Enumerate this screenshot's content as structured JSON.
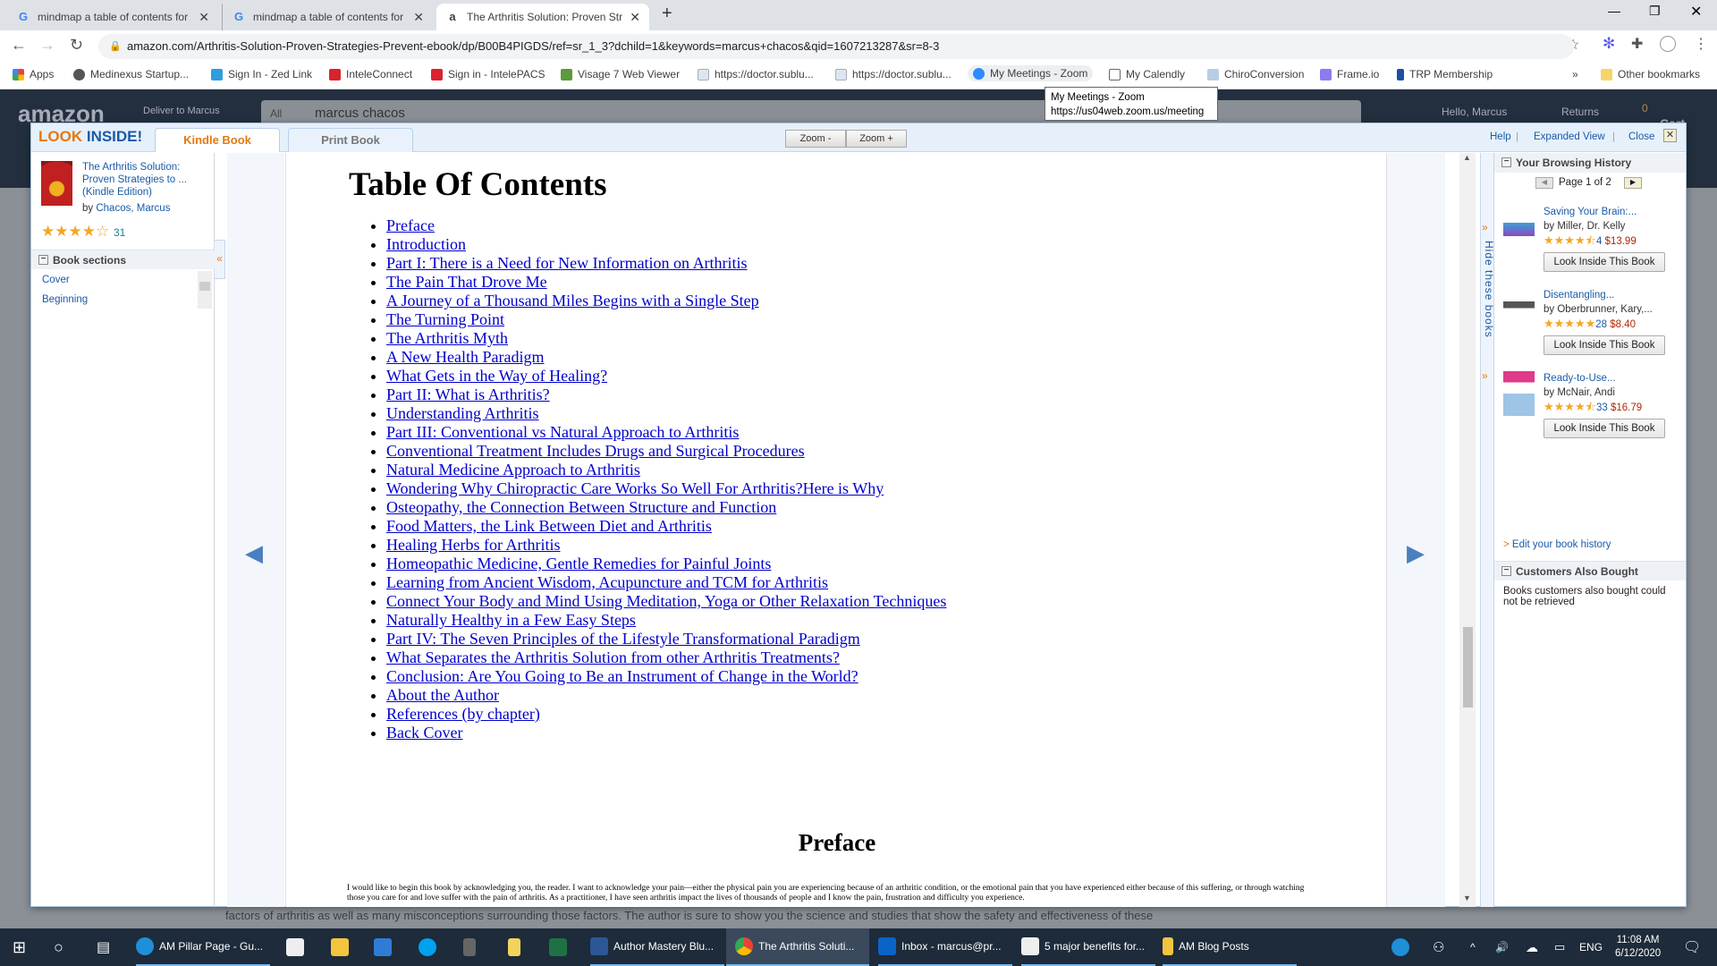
{
  "browser": {
    "tabs": [
      {
        "title": "mindmap a table of contents for",
        "icon": "google-icon"
      },
      {
        "title": "mindmap a table of contents for",
        "icon": "google-icon"
      },
      {
        "title": "The Arthritis Solution: Proven Str",
        "icon": "amazon-icon",
        "active": true
      }
    ],
    "url": "amazon.com/Arthritis-Solution-Proven-Strategies-Prevent-ebook/dp/B00B4PIGDS/ref=sr_1_3?dchild=1&keywords=marcus+chacos&qid=1607213287&sr=8-3",
    "bookmarks": [
      "Apps",
      "Medinexus Startup...",
      "Sign In - Zed Link",
      "InteleConnect",
      "Sign in - IntelePACS",
      "Visage 7 Web Viewer",
      "https://doctor.sublu...",
      "https://doctor.sublu...",
      "My Meetings - Zoom",
      "My Calendly",
      "ChiroConversion",
      "Frame.io",
      "TRP Membership"
    ],
    "other_bookmarks": "Other bookmarks",
    "tooltip": {
      "title": "My Meetings - Zoom",
      "url": "https://us04web.zoom.us/meeting"
    }
  },
  "amazon": {
    "logo": "amazon",
    "deliver": "Deliver to Marcus",
    "search_scope": "All",
    "search_value": "marcus chacos",
    "hello": "Hello, Marcus",
    "returns": "Returns",
    "cart_count": "0",
    "cart": "Cart"
  },
  "modal": {
    "logo_look": "LOOK",
    "logo_inside": "INSIDE!",
    "tabs": [
      "Kindle Book",
      "Print Book"
    ],
    "zoom_minus": "Zoom -",
    "zoom_plus": "Zoom +",
    "help": "Help",
    "expanded": "Expanded View",
    "close": "Close",
    "book": {
      "title": "The Arthritis Solution: Proven Strategies to ... (Kindle Edition)",
      "by": "by",
      "author": "Chacos, Marcus",
      "rating": 4,
      "reviews": "31"
    },
    "sections_header": "Book sections",
    "sections": [
      "Cover",
      "Beginning"
    ],
    "content": {
      "toc_title": "Table Of Contents",
      "toc": [
        "Preface",
        "Introduction",
        "Part I: There is a Need for New Information on Arthritis",
        "The Pain That Drove Me",
        "A Journey of a Thousand Miles Begins with a Single Step",
        "The Turning Point",
        "The Arthritis Myth",
        "A New Health Paradigm",
        "What Gets in the Way of Healing?",
        "Part II: What is Arthritis?",
        "Understanding Arthritis",
        "Part III: Conventional vs Natural Approach to Arthritis",
        "Conventional Treatment Includes Drugs and Surgical Procedures",
        "Natural Medicine Approach to Arthritis",
        "Wondering Why Chiropractic Care Works So Well For Arthritis?Here is Why",
        "Osteopathy, the Connection Between Structure and Function",
        "Food Matters, the Link Between Diet and Arthritis",
        "Healing Herbs for Arthritis",
        "Homeopathic Medicine, Gentle Remedies for Painful Joints",
        "Learning from Ancient Wisdom, Acupuncture and TCM for Arthritis",
        "Connect Your Body and Mind Using Meditation, Yoga or Other Relaxation Techniques",
        "Naturally Healthy in a Few Easy Steps",
        "Part IV: The Seven Principles of the Lifestyle Transformational Paradigm",
        "What Separates the Arthritis Solution from other Arthritis Treatments?",
        "Conclusion: Are You Going to Be an Instrument of Change in the World?",
        "About the Author",
        "References (by chapter)",
        "Back Cover"
      ],
      "preface_title": "Preface",
      "preface_text": "I would like to begin this book by acknowledging you, the reader. I want to acknowledge your pain—either the physical pain you are experiencing because of an arthritic condition, or the emotional pain that you have experienced either because of this suffering, or through watching those you care for and love suffer with the pain of arthritis. As a practitioner, I have seen arthritis impact the lives of thousands of people and I know the pain, frustration and difficulty you experience."
    },
    "hide_books": "Hide these books",
    "history": {
      "header": "Your Browsing History",
      "page": "Page 1 of 2",
      "books": [
        {
          "title": "Saving Your Brain:...",
          "author": "by Miller, Dr. Kelly",
          "rating": 4.5,
          "count": "4",
          "price": "$13.99",
          "button": "Look Inside This Book"
        },
        {
          "title": "Disentangling...",
          "author": "by Oberbrunner, Kary,...",
          "rating": 5,
          "count": "28",
          "price": "$8.40",
          "button": "Look Inside This Book"
        },
        {
          "title": "Ready-to-Use...",
          "author": "by McNair, Andi",
          "rating": 4.5,
          "count": "33",
          "price": "$16.79",
          "button": "Look Inside This Book"
        }
      ],
      "edit": "Edit your book history"
    },
    "also_bought": {
      "header": "Customers Also Bought",
      "text": "Books customers also bought could not be retrieved"
    }
  },
  "behind_text": "factors of arthritis as well as many misconceptions surrounding those factors. The author is sure to show you the science and studies that show the safety and effectiveness of these",
  "taskbar": {
    "apps": [
      "AM Pillar Page - Gu...",
      "Author Mastery Blu...",
      "The Arthritis Soluti...",
      "Inbox - marcus@pr...",
      "5 major benefits for...",
      "AM Blog Posts"
    ],
    "lang": "ENG",
    "time": "11:08 AM",
    "date": "6/12/2020"
  },
  "colors": {
    "accent_orange": "#e47911",
    "link_blue": "#1a5ba8",
    "price_red": "#b12704",
    "amazon_dark": "#232f3e"
  }
}
